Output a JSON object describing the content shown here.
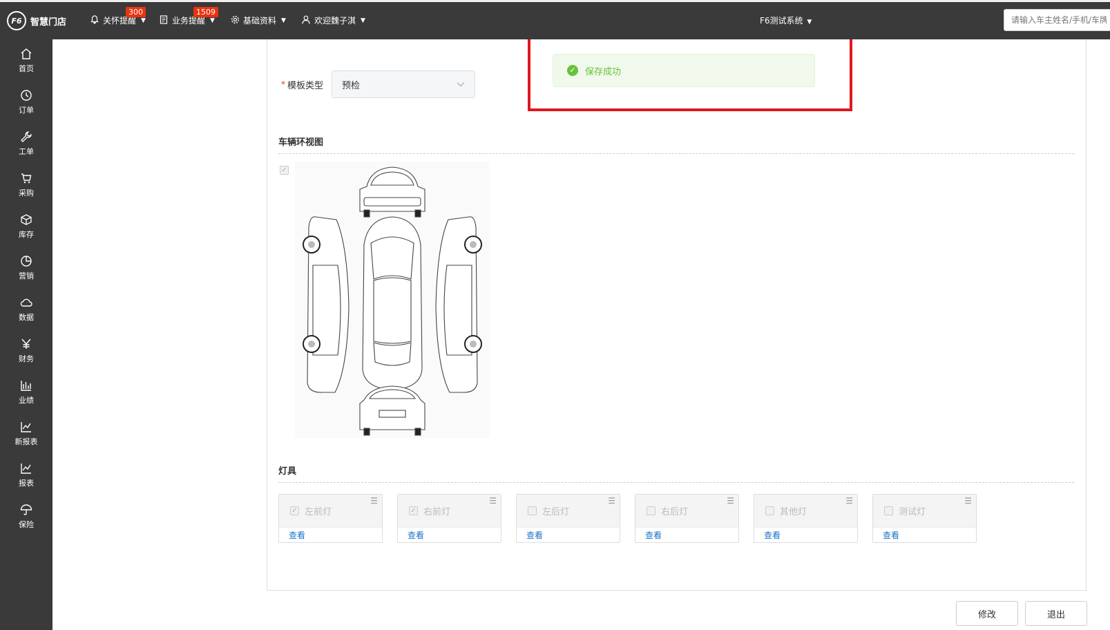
{
  "header": {
    "logo_text": "智慧门店",
    "logo_mark": "F6",
    "nav": [
      {
        "label": "关怀提醒",
        "badge": "300",
        "icon": "bell-icon"
      },
      {
        "label": "业务提醒",
        "badge": "1509",
        "icon": "document-icon"
      },
      {
        "label": "基础资料",
        "icon": "gear-icon"
      },
      {
        "label": "欢迎魏子淇",
        "icon": "user-icon"
      }
    ],
    "system_title": "F6测试系统",
    "search_placeholder": "请输入车主姓名/手机/车牌"
  },
  "sidebar": {
    "items": [
      {
        "label": "首页",
        "icon": "home-icon"
      },
      {
        "label": "订单",
        "icon": "history-icon"
      },
      {
        "label": "工单",
        "icon": "wrench-icon"
      },
      {
        "label": "采购",
        "icon": "cart-icon"
      },
      {
        "label": "库存",
        "icon": "box-icon"
      },
      {
        "label": "营销",
        "icon": "pie-chart-icon"
      },
      {
        "label": "数据",
        "icon": "cloud-icon"
      },
      {
        "label": "财务",
        "icon": "yen-icon"
      },
      {
        "label": "业绩",
        "icon": "bar-chart-icon"
      },
      {
        "label": "新报表",
        "icon": "line-chart-icon"
      },
      {
        "label": "报表",
        "icon": "line-chart-icon"
      },
      {
        "label": "保险",
        "icon": "umbrella-icon"
      }
    ]
  },
  "form": {
    "required_mark": "*",
    "template_type_label": "模板类型",
    "template_type_value": "预检"
  },
  "sections": {
    "vehicle_view_title": "车辆环视图",
    "lamps_title": "灯具"
  },
  "lamps": [
    {
      "name": "左前灯",
      "checked": true,
      "view": "查看"
    },
    {
      "name": "右前灯",
      "checked": true,
      "view": "查看"
    },
    {
      "name": "左后灯",
      "checked": false,
      "view": "查看"
    },
    {
      "name": "右后灯",
      "checked": false,
      "view": "查看"
    },
    {
      "name": "其他灯",
      "checked": false,
      "view": "查看"
    },
    {
      "name": "测试灯",
      "checked": false,
      "view": "查看"
    }
  ],
  "toast": {
    "message": "保存成功",
    "type": "success",
    "color": "#67c23a"
  },
  "buttons": {
    "modify": "修改",
    "exit": "退出"
  },
  "colors": {
    "topbar": "#3a3a3a",
    "badge": "#e8340e",
    "link": "#1a73c9",
    "highlight": "#e0161f"
  }
}
